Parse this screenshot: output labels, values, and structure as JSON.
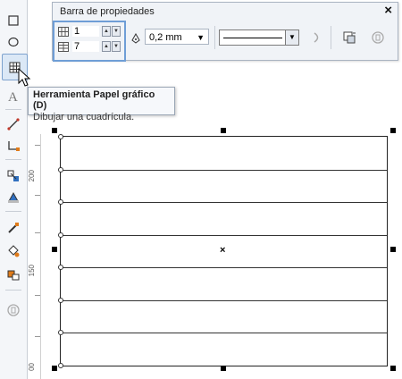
{
  "property_bar": {
    "title": "Barra de propiedades",
    "close_glyph": "×",
    "columns_value": "1",
    "rows_value": "7",
    "outline_width": "0,2 mm",
    "spin_up_glyph": "▲",
    "spin_down_glyph": "▼",
    "select_arrow_glyph": "▼"
  },
  "tooltip": {
    "title": "Herramienta Papel gráfico (D)",
    "description": "Dibujar una cuadrícula."
  },
  "ruler": {
    "labels": [
      "200",
      "150",
      "00"
    ]
  },
  "graph_paper": {
    "rows": 7,
    "columns": 1
  },
  "center_mark": "×",
  "icons": {
    "toolbox": [
      "rectangle-icon",
      "ellipse-icon",
      "graph-paper-icon",
      "text-icon",
      "dimension-icon",
      "connector-icon",
      "blend-icon",
      "transparency-icon",
      "eyedropper-icon",
      "fill-icon",
      "interactive-fill-icon",
      "smart-fill-icon"
    ]
  }
}
